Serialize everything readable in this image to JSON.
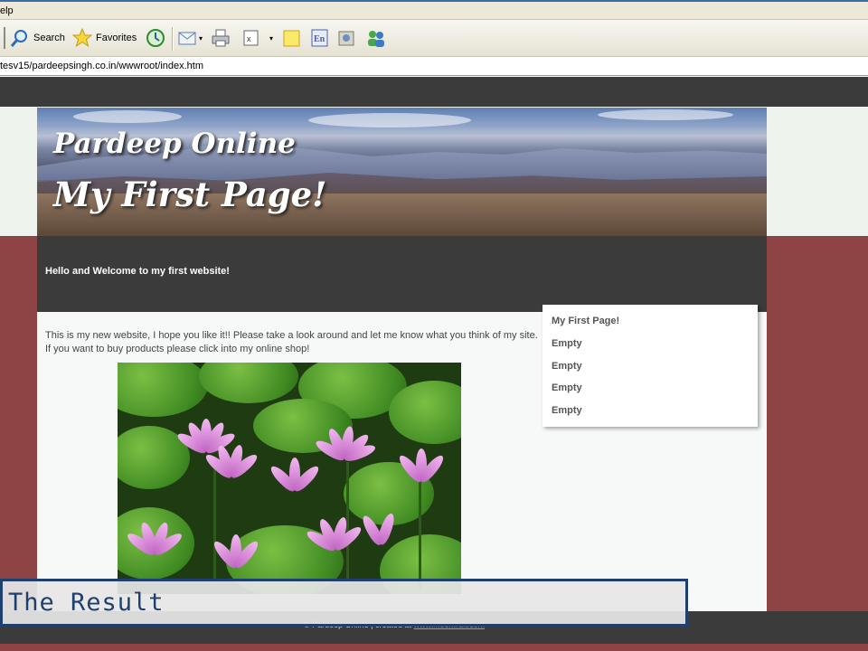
{
  "browser": {
    "menu_label": "elp",
    "toolbar": {
      "search_label": "Search",
      "favorites_label": "Favorites"
    },
    "address": "tesv15/pardeepsingh.co.in/wwwroot/index.htm"
  },
  "site": {
    "banner": {
      "title_line1": "Pardeep Online",
      "title_line2": "My First Page!"
    },
    "welcome": "Hello and Welcome to my first website!",
    "intro": "This is my new website, I hope you like it!! Please take a look around and let me know what you think of my site. If you want to buy products please click into my online shop!",
    "sidebar": {
      "items": [
        {
          "label": "My First Page!"
        },
        {
          "label": "Empty"
        },
        {
          "label": "Empty"
        },
        {
          "label": "Empty"
        },
        {
          "label": "Empty"
        }
      ]
    },
    "footer": {
      "copyright": "© Pardeep Online | created at",
      "link": "www.moonfruit.com"
    }
  },
  "slide": {
    "caption": "The Result"
  },
  "colors": {
    "dark_band": "#3b3b3b",
    "maroon_bg": "#8e4444",
    "caption_border": "#1f3f6e"
  }
}
